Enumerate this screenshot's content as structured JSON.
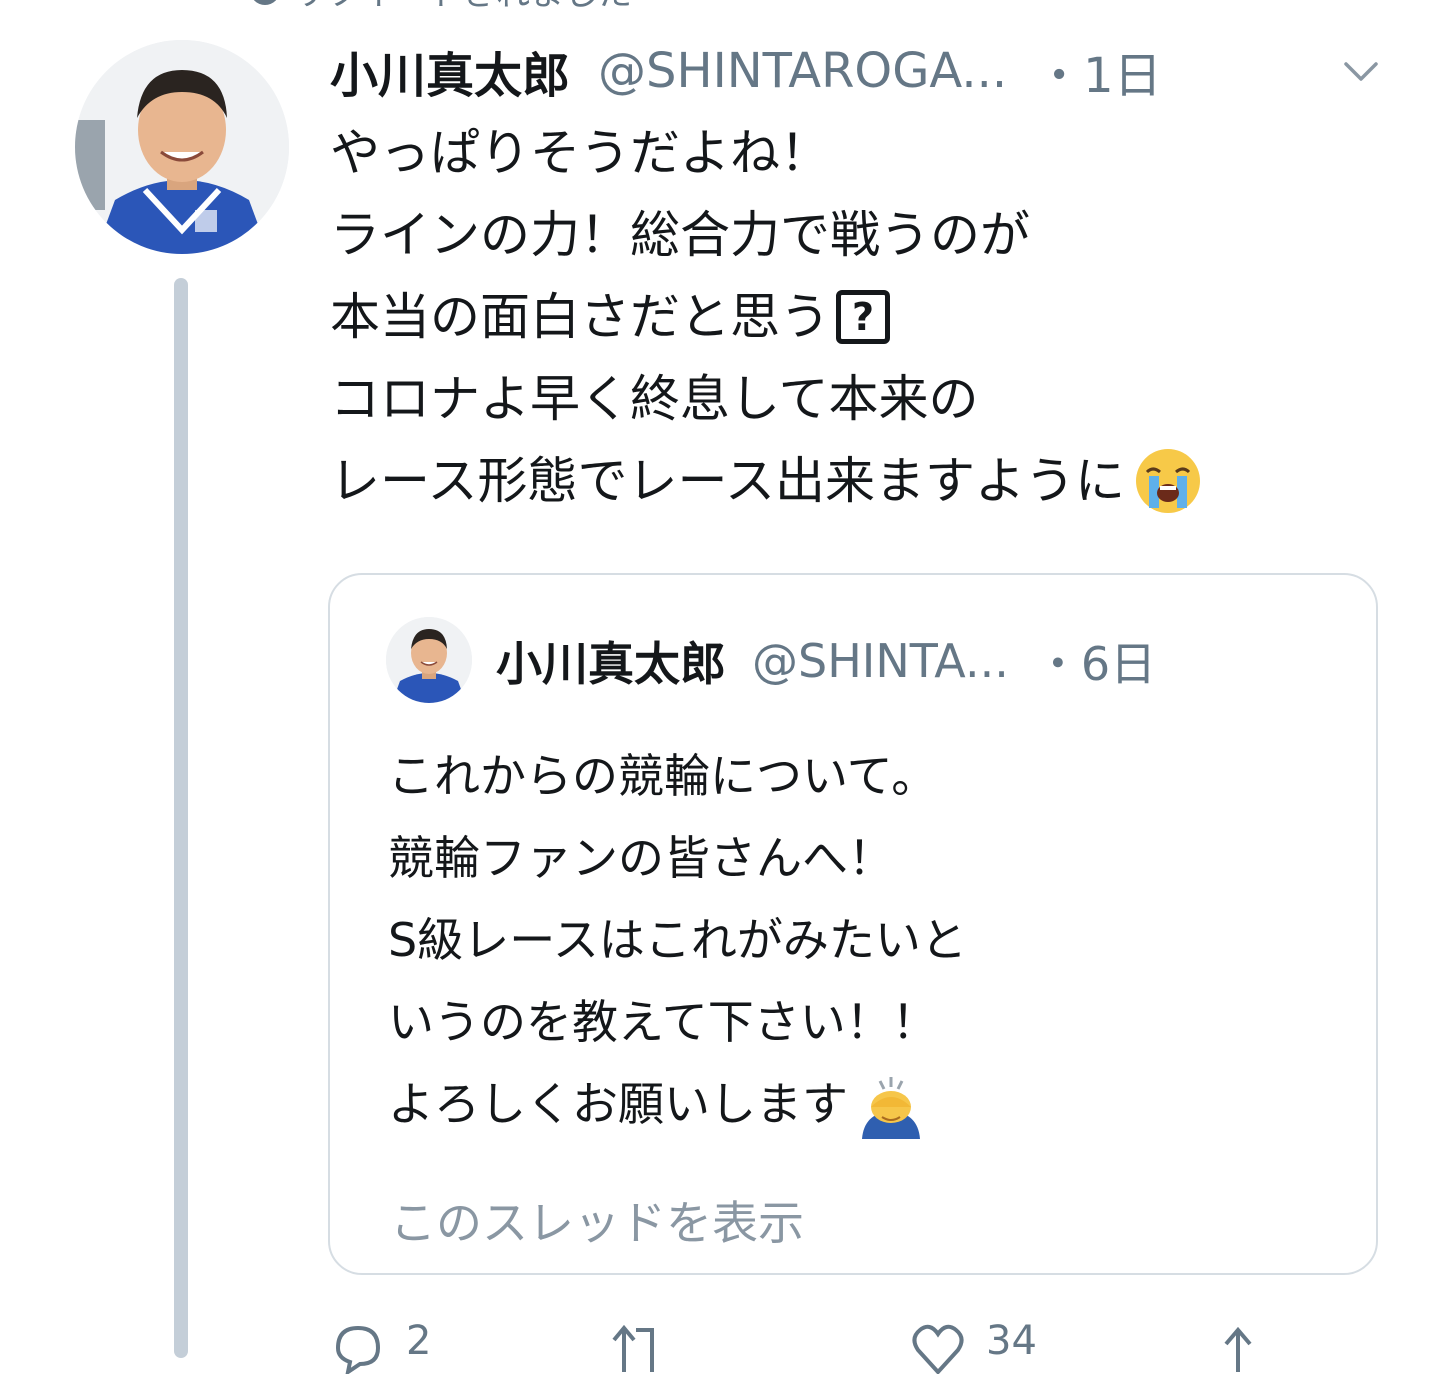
{
  "context": {
    "clipped_text": "リツイートされました"
  },
  "tweet": {
    "display_name": "小川真太郎",
    "handle": "@SHINTAROGA...",
    "time": "・1日",
    "lines": [
      "やっぱりそうだよね！",
      "ラインの力！総合力で戦うのが",
      "本当の面白さだと思う",
      "コロナよ早く終息して本来の",
      "レース形態でレース出来ますように"
    ],
    "missing_glyph": "?",
    "emojis": [
      "loudly-crying-face",
      "person-bowing"
    ]
  },
  "quote": {
    "display_name": "小川真太郎",
    "handle": "@SHINTA...",
    "time": "・6日",
    "lines": [
      "これからの競輪について。",
      "競輪ファンの皆さんへ！",
      "S級レースはこれがみたいと",
      "いうのを教えて下さい！！",
      "よろしくお願いします"
    ],
    "show_thread": "このスレッドを表示"
  },
  "actions": {
    "reply_count": "2",
    "like_count": "34"
  },
  "colors": {
    "text": "#14171a",
    "secondary": "#657786",
    "thread_line": "#c4ced8",
    "card_border": "#d6dde3"
  },
  "icons": [
    "chevron-down-icon",
    "reply-icon",
    "retweet-icon",
    "like-icon",
    "share-icon"
  ]
}
